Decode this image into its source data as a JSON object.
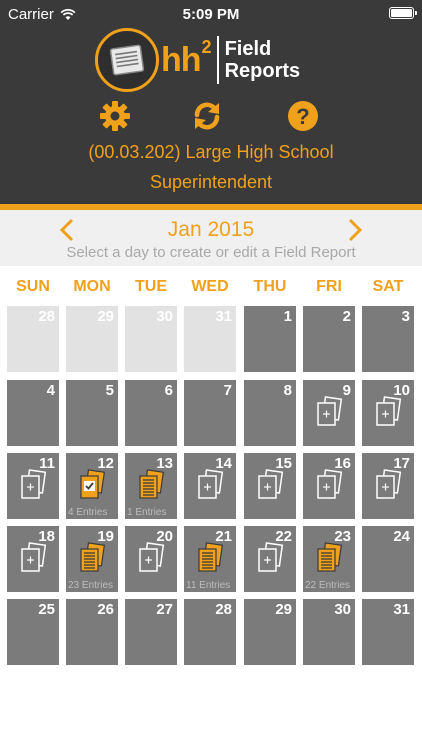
{
  "status_bar": {
    "carrier": "Carrier",
    "time": "5:09 PM"
  },
  "app": {
    "logo_hh": "hh",
    "logo_sup": "2",
    "logo_field": "Field",
    "logo_reports": "Reports"
  },
  "header": {
    "icons": [
      "gear-icon",
      "sync-icon",
      "help-icon"
    ],
    "project": "(00.03.202) Large High School",
    "role": "Superintendent"
  },
  "calendar": {
    "month": "Jan 2015",
    "instruction": "Select a day to create or edit a Field Report",
    "weekdays": [
      "SUN",
      "MON",
      "TUE",
      "WED",
      "THU",
      "FRI",
      "SAT"
    ],
    "weeks": [
      [
        {
          "day": "28",
          "other": true
        },
        {
          "day": "29",
          "other": true
        },
        {
          "day": "30",
          "other": true
        },
        {
          "day": "31",
          "other": true
        },
        {
          "day": "1"
        },
        {
          "day": "2"
        },
        {
          "day": "3"
        }
      ],
      [
        {
          "day": "4"
        },
        {
          "day": "5"
        },
        {
          "day": "6"
        },
        {
          "day": "7"
        },
        {
          "day": "8"
        },
        {
          "day": "9",
          "icon": "new"
        },
        {
          "day": "10",
          "icon": "new"
        }
      ],
      [
        {
          "day": "11",
          "icon": "new"
        },
        {
          "day": "12",
          "icon": "check",
          "entries": "4 Entries"
        },
        {
          "day": "13",
          "icon": "report",
          "entries": "1 Entries"
        },
        {
          "day": "14",
          "icon": "new"
        },
        {
          "day": "15",
          "icon": "new"
        },
        {
          "day": "16",
          "icon": "new"
        },
        {
          "day": "17",
          "icon": "new"
        }
      ],
      [
        {
          "day": "18",
          "icon": "new"
        },
        {
          "day": "19",
          "icon": "report",
          "entries": "23 Entries"
        },
        {
          "day": "20",
          "icon": "new"
        },
        {
          "day": "21",
          "icon": "report",
          "entries": "11 Entries"
        },
        {
          "day": "22",
          "icon": "new"
        },
        {
          "day": "23",
          "icon": "report",
          "entries": "22 Entries"
        },
        {
          "day": "24"
        }
      ],
      [
        {
          "day": "25"
        },
        {
          "day": "26"
        },
        {
          "day": "27"
        },
        {
          "day": "28"
        },
        {
          "day": "29"
        },
        {
          "day": "30"
        },
        {
          "day": "31"
        }
      ]
    ]
  },
  "colors": {
    "accent": "#f0a11c",
    "header_bg": "#3a3a3a",
    "day_bg": "#7b7b7b",
    "other_month_bg": "#e2e2e2"
  }
}
